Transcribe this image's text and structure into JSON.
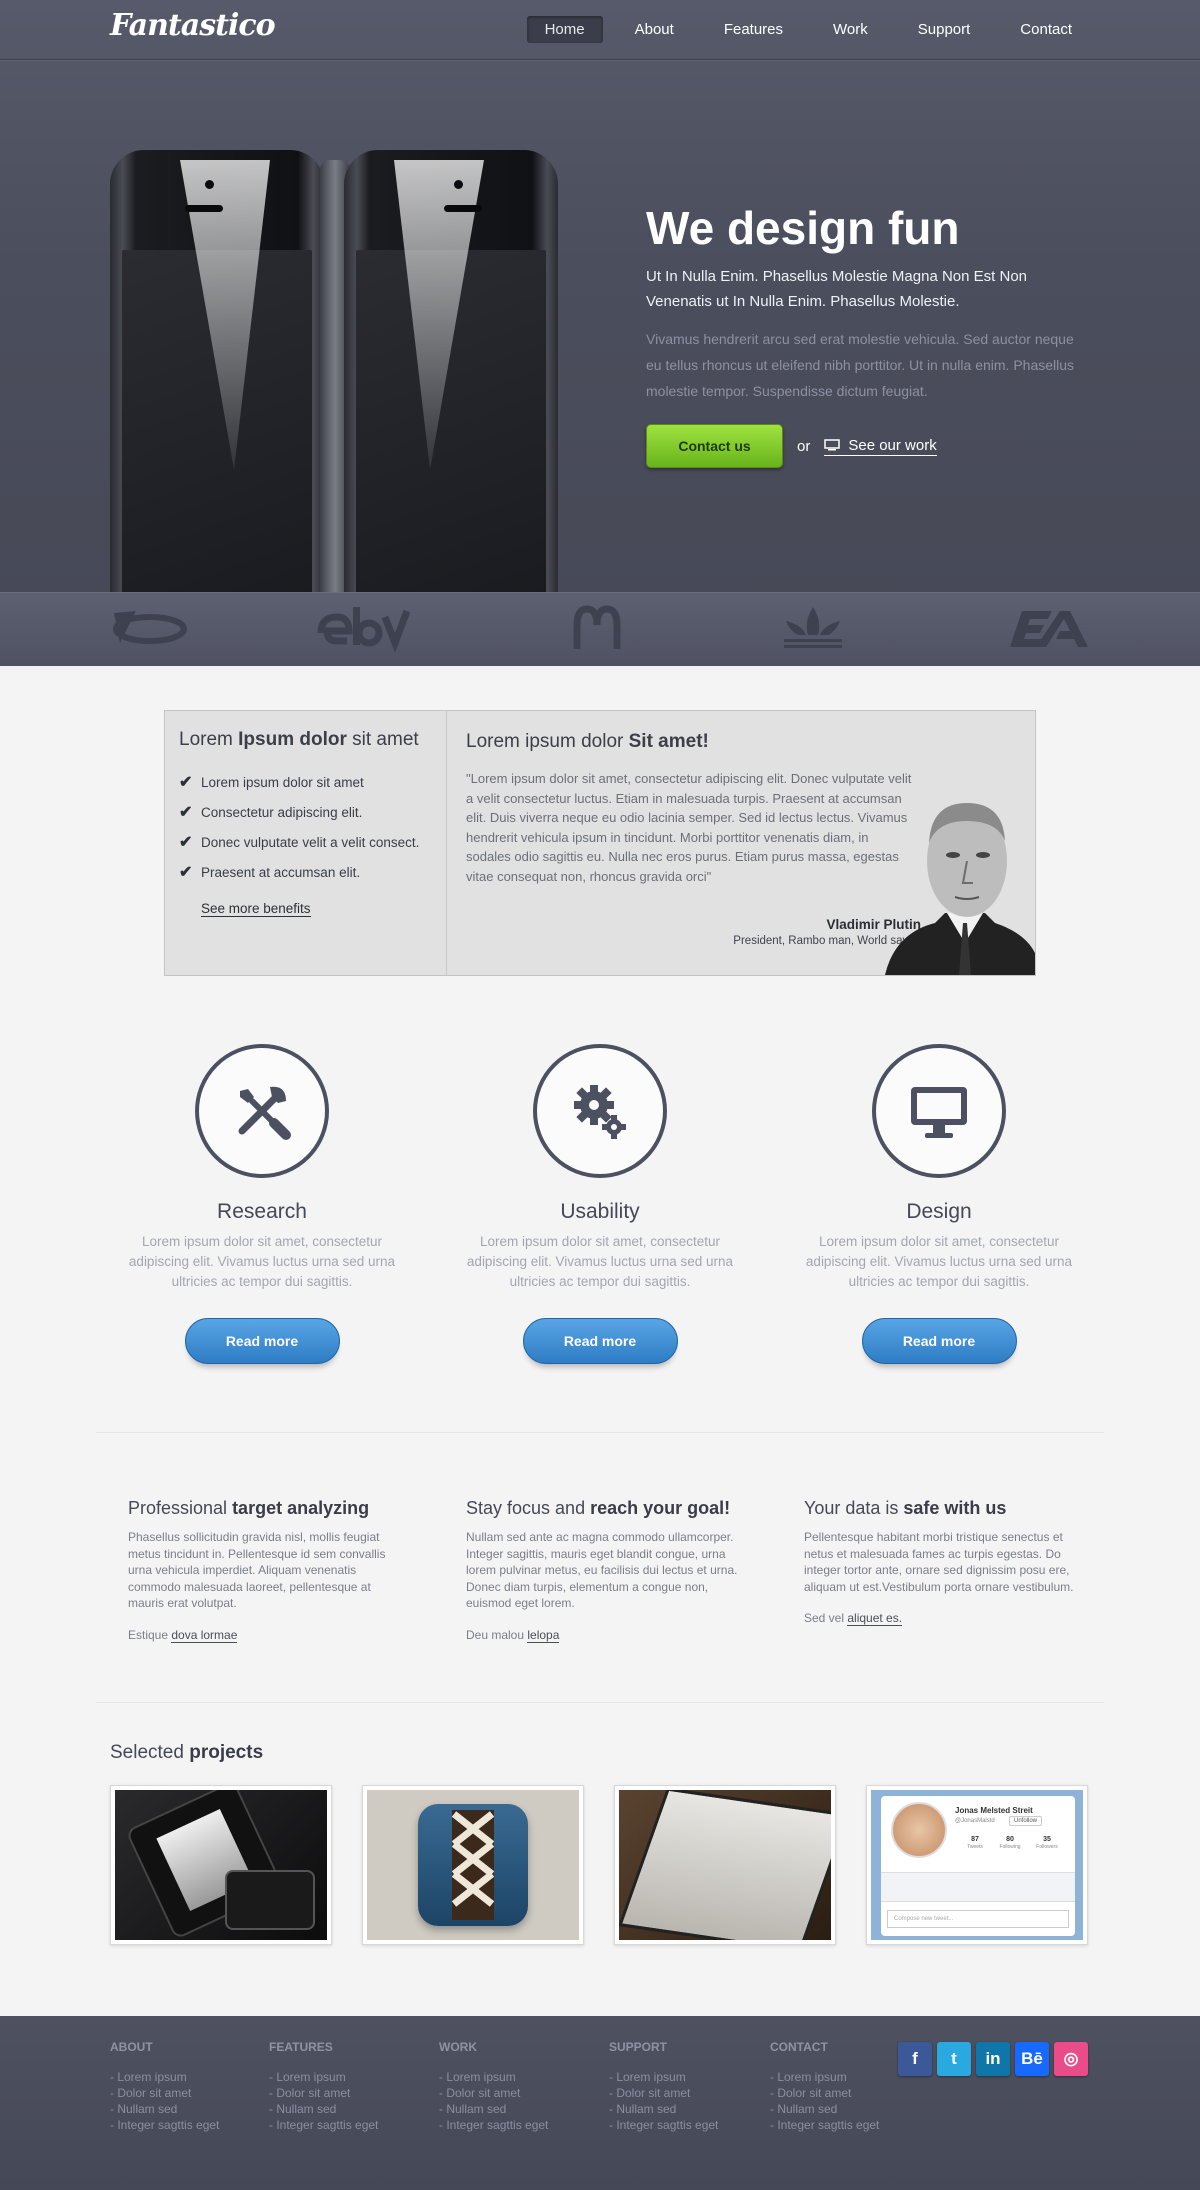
{
  "header": {
    "logo": "Fantastico",
    "nav": [
      {
        "label": "Home",
        "active": true
      },
      {
        "label": "About"
      },
      {
        "label": "Features"
      },
      {
        "label": "Work"
      },
      {
        "label": "Support"
      },
      {
        "label": "Contact"
      }
    ]
  },
  "hero": {
    "title": "We design fun",
    "lead": "Ut In Nulla Enim. Phasellus Molestie Magna Non Est Non Venenatis ut In Nulla Enim. Phasellus Molestie.",
    "body": "Vivamus hendrerit arcu sed erat molestie vehicula. Sed auctor neque eu tellus rhoncus ut eleifend nibh porttitor. Ut in nulla enim. Phasellus molestie tempor. Suspendisse dictum feugiat.",
    "cta_label": "Contact us",
    "or_text": "or",
    "secondary_label": "See our work"
  },
  "brands": [
    "dreamworks-logo",
    "ebay-logo",
    "mcdonalds-logo",
    "adidas-logo",
    "ea-logo"
  ],
  "benefits": {
    "title_pre": "Lorem ",
    "title_bold": "Ipsum dolor",
    "title_post": " sit amet",
    "items": [
      "Lorem ipsum dolor sit amet",
      "Consectetur adipiscing elit.",
      "Donec vulputate velit a velit consect.",
      "Praesent at accumsan elit."
    ],
    "link": "See more benefits"
  },
  "testimonial": {
    "title_pre": "Lorem ipsum dolor ",
    "title_bold": "Sit amet!",
    "quote": "\"Lorem ipsum dolor sit amet, consectetur adipiscing elit. Donec vulputate velit a velit consectetur luctus. Etiam in malesuada turpis. Praesent at accumsan elit. Duis viverra neque eu odio lacinia semper. Sed id lectus lectus. Vivamus hendrerit vehicula ipsum in tincidunt. Morbi porttitor venenatis diam, in sodales odio sagittis eu. Nulla nec eros purus. Etiam purus massa, egestas vitae consequat non, rhoncus gravida orci\"",
    "author": "Vladimir Plutin",
    "role": "President, Rambo man, World savior"
  },
  "features": [
    {
      "title": "Research",
      "text": "Lorem ipsum dolor sit amet, consectetur adipiscing elit. Vivamus luctus urna sed urna ultricies ac tempor dui sagittis.",
      "button": "Read more",
      "icon": "tools-icon"
    },
    {
      "title": "Usability",
      "text": "Lorem ipsum dolor sit amet, consectetur adipiscing elit. Vivamus luctus urna sed urna ultricies ac tempor dui sagittis.",
      "button": "Read more",
      "icon": "gears-icon"
    },
    {
      "title": "Design",
      "text": "Lorem ipsum dolor sit amet, consectetur adipiscing elit. Vivamus luctus urna sed urna ultricies ac tempor dui sagittis.",
      "button": "Read more",
      "icon": "monitor-icon"
    }
  ],
  "columns": [
    {
      "title_pre": "Professional ",
      "title_bold": "target analyzing",
      "text": "Phasellus sollicitudin gravida nisl, mollis feugiat metus tincidunt in. Pellentesque id sem convallis urna vehicula imperdiet. Aliquam venenatis commodo malesuada laoreet, pellentesque at mauris erat volutpat.",
      "link_pre": "Estique ",
      "link": "dova lormae"
    },
    {
      "title_pre": "Stay focus and ",
      "title_bold": "reach your goal!",
      "text": "Nullam sed ante ac magna commodo ullamcorper. Integer sagittis, mauris eget blandit congue, urna lorem pulvinar metus, eu facilisis dui lectus et urna. Donec diam turpis, elementum a congue non, euismod eget lorem.",
      "link_pre": "Deu malou ",
      "link": "lelopa"
    },
    {
      "title_pre": "Your data is ",
      "title_bold": "safe with us",
      "text": "Pellentesque habitant morbi tristique senectus et netus et malesuada fames ac turpis egestas. Do integer tortor ante, ornare sed dignissim posu ere, aliquam ut est.Vestibulum porta ornare vestibulum.",
      "link_pre": "Sed vel ",
      "link": "aliquet es."
    }
  ],
  "projects": {
    "title_pre": "Selected ",
    "title_bold": "projects",
    "profile": {
      "name": "Jonas Melsted Streit",
      "handle": "@JonasMalstd",
      "follow": "Unfollow",
      "stats": [
        {
          "n": "87",
          "l": "Tweets"
        },
        {
          "n": "80",
          "l": "Following"
        },
        {
          "n": "35",
          "l": "Followers"
        }
      ],
      "compose": "Compose new tweet..."
    }
  },
  "footer": {
    "columns": [
      {
        "title": "About",
        "links": [
          "- Lorem ipsum",
          "- Dolor sit amet",
          "- Nullam sed",
          "- Integer sagttis eget"
        ]
      },
      {
        "title": "Features",
        "links": [
          "- Lorem ipsum",
          "- Dolor sit amet",
          "- Nullam sed",
          "- Integer sagttis eget"
        ]
      },
      {
        "title": "Work",
        "links": [
          "- Lorem ipsum",
          "- Dolor sit amet",
          "- Nullam sed",
          "- Integer sagttis eget"
        ]
      },
      {
        "title": "Support",
        "links": [
          "- Lorem ipsum",
          "- Dolor sit amet",
          "- Nullam sed",
          "- Integer sagttis eget"
        ]
      },
      {
        "title": "Contact",
        "links": [
          "- Lorem ipsum",
          "- Dolor sit amet",
          "- Nullam sed",
          "- Integer sagttis eget"
        ]
      }
    ],
    "socials": [
      {
        "label": "f",
        "icon": "facebook-icon",
        "color": "#3b5998"
      },
      {
        "label": "t",
        "icon": "twitter-icon",
        "color": "#2aa9e0"
      },
      {
        "label": "in",
        "icon": "linkedin-icon",
        "color": "#0e76a8"
      },
      {
        "label": "Bē",
        "icon": "behance-icon",
        "color": "#1769ff"
      },
      {
        "label": "◎",
        "icon": "dribbble-icon",
        "color": "#ea4c89"
      }
    ]
  },
  "colors": {
    "accent_green": "#7cc62a",
    "accent_blue": "#3a8bd3",
    "hero_bg": "#4b4e5c"
  }
}
